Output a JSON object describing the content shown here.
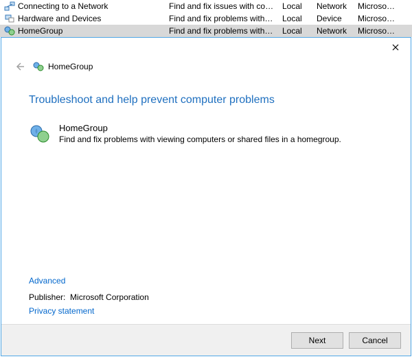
{
  "list": {
    "rows": [
      {
        "name": "Connecting to a Network",
        "desc": "Find and fix issues with co…",
        "loc": "Local",
        "cat": "Network",
        "pub": "Microso…"
      },
      {
        "name": "Hardware and Devices",
        "desc": "Find and fix problems with…",
        "loc": "Local",
        "cat": "Device",
        "pub": "Microso…"
      },
      {
        "name": "HomeGroup",
        "desc": "Find and fix problems with…",
        "loc": "Local",
        "cat": "Network",
        "pub": "Microso…"
      }
    ]
  },
  "wizard": {
    "header_title": "HomeGroup",
    "heading": "Troubleshoot and help prevent computer problems",
    "item_title": "HomeGroup",
    "item_desc": "Find and fix problems with viewing computers or shared files in a homegroup.",
    "advanced": "Advanced",
    "publisher_label": "Publisher:",
    "publisher_value": "Microsoft Corporation",
    "privacy": "Privacy statement",
    "next": "Next",
    "cancel": "Cancel"
  }
}
